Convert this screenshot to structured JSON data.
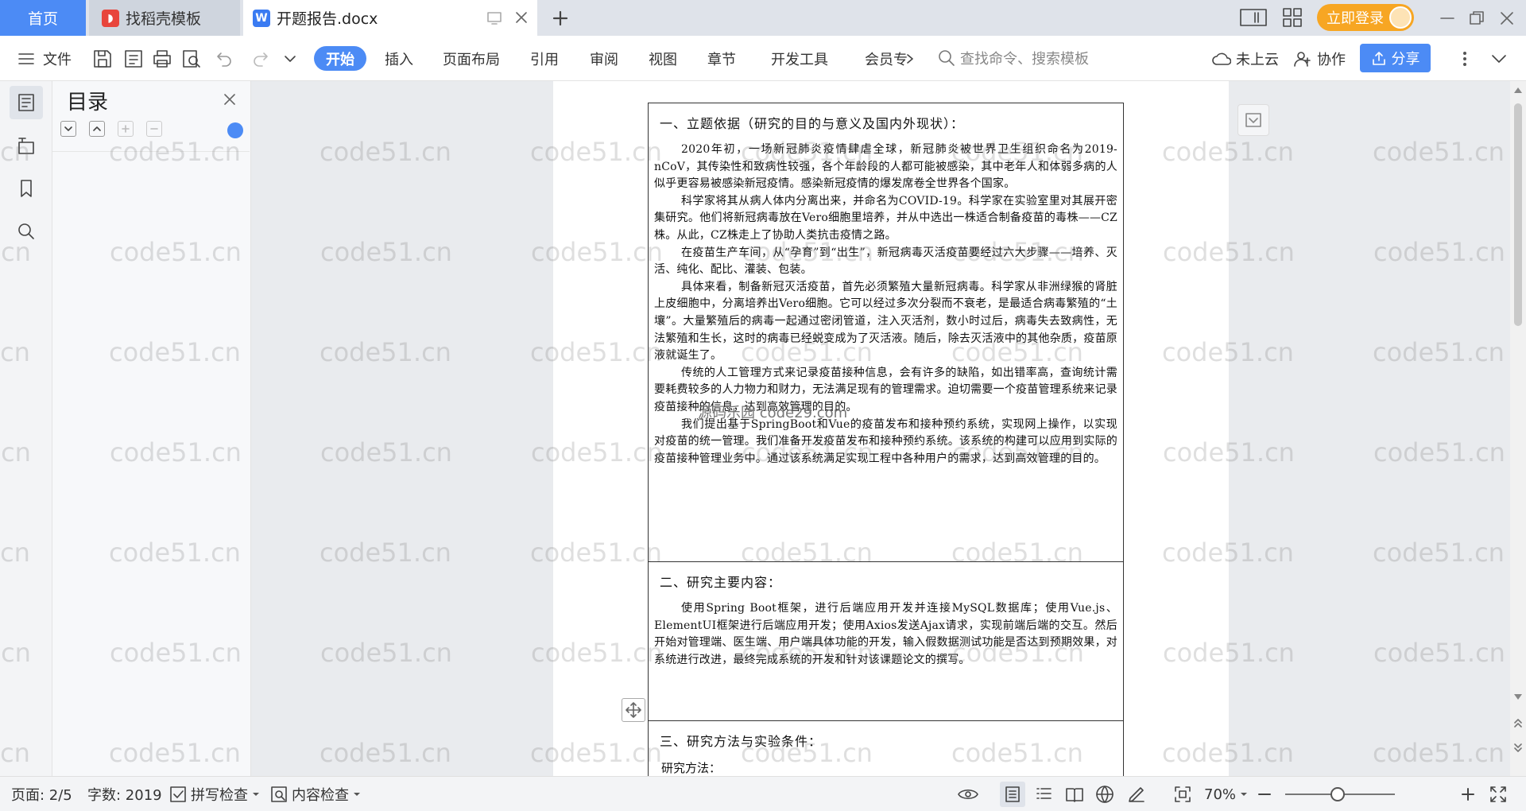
{
  "tabs": {
    "home": "首页",
    "daoke": "找稻壳模板",
    "doc": "开题报告.docx",
    "login": "立即登录"
  },
  "menu": {
    "file": "文件",
    "items": [
      "开始",
      "插入",
      "页面布局",
      "引用",
      "审阅",
      "视图",
      "章节",
      "开发工具",
      "会员专"
    ],
    "search_placeholder": "查找命令、搜索模板",
    "cloud": "未上云",
    "collab": "协作",
    "share": "分享"
  },
  "toc": {
    "title": "目录"
  },
  "doc": {
    "s1_title": "一、立题依据（研究的目的与意义及国内外现状）：",
    "s1_paras": [
      "2020年初，一场新冠肺炎疫情肆虐全球，新冠肺炎被世界卫生组织命名为2019-nCoV，其传染性和致病性较强，各个年龄段的人都可能被感染，其中老年人和体弱多病的人似乎更容易被感染新冠疫情。感染新冠疫情的爆发席卷全世界各个国家。",
      "科学家将其从病人体内分离出来，并命名为COVID-19。科学家在实验室里对其展开密集研究。他们将新冠病毒放在Vero细胞里培养，并从中选出一株适合制备疫苗的毒株——CZ株。从此，CZ株走上了协助人类抗击疫情之路。",
      "在疫苗生产车间，从“孕育”到“出生”，新冠病毒灭活疫苗要经过六大步骤——培养、灭活、纯化、配比、灌装、包装。",
      "具体来看，制备新冠灭活疫苗，首先必须繁殖大量新冠病毒。科学家从非洲绿猴的肾脏上皮细胞中，分离培养出Vero细胞。它可以经过多次分裂而不衰老，是最适合病毒繁殖的“土壤”。大量繁殖后的病毒一起通过密闭管道，注入灭活剂，数小时过后，病毒失去致病性，无法繁殖和生长，这时的病毒已经蜕变成为了灭活液。随后，除去灭活液中的其他杂质，疫苗原液就诞生了。",
      "传统的人工管理方式来记录疫苗接种信息，会有许多的缺陷，如出错率高，查询统计需要耗费较多的人力物力和财力，无法满足现有的管理需求。迫切需要一个疫苗管理系统来记录疫苗接种的信息，达到高效管理的目的。",
      "我们提出基于SpringBoot和Vue的疫苗发布和接种预约系统，实现网上操作，以实现对疫苗的统一管理。我们准备开发疫苗发布和接种预约系统。该系统的构建可以应用到实际的疫苗接种管理业务中。通过该系统满足实现工程中各种用户的需求，达到高效管理的目的。"
    ],
    "s2_title": "二、研究主要内容：",
    "s2_paras": [
      "使用Spring Boot框架，进行后端应用开发并连接MySQL数据库；使用Vue.js、ElementUI框架进行后端应用开发；使用Axios发送Ajax请求，实现前端后端的交互。然后开始对管理端、医生端、用户端具体功能的开发，输入假数据测试功能是否达到预期效果，对系统进行改进，最终完成系统的开发和针对该课题论文的撰写。"
    ],
    "s3_title": "三、研究方法与实验条件：",
    "s3_sub": "研究方法："
  },
  "watermark": "code51.cn",
  "inner_watermark": "源码乐园 code29.com",
  "status": {
    "page": "页面: 2/5",
    "words": "字数: 2019",
    "spell": "拼写检查",
    "content": "内容检查",
    "zoom": "70%"
  }
}
